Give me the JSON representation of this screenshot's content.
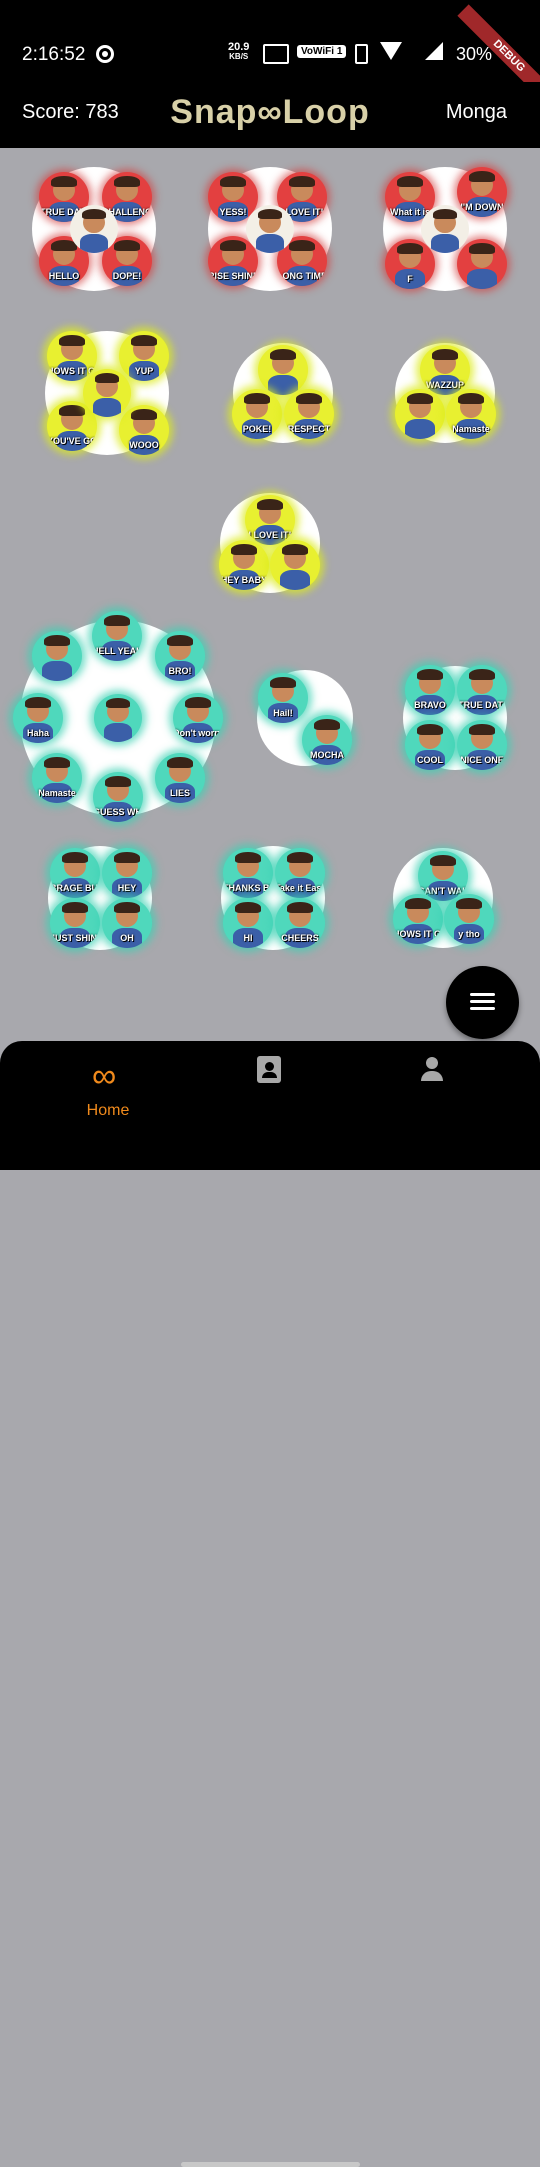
{
  "status_bar": {
    "time": "2:16:52",
    "net_speed_value": "20.9",
    "net_speed_unit": "KB/S",
    "wifi_label": "VoWiFi 1",
    "battery": "30%"
  },
  "debug_banner": "DEBUG",
  "app_bar": {
    "score": "Score: 783",
    "title": "Snap∞Loop",
    "username": "Monga"
  },
  "clusters": [
    {
      "color": "red",
      "stickers": [
        "TRUE DAT!",
        "CHALLENGE",
        "HELLO",
        "DOPE!",
        ""
      ]
    },
    {
      "color": "red",
      "stickers": [
        "YESS!",
        "I LOVE IT!",
        "RISE SHINE",
        "LONG TIME NO SEE",
        ""
      ]
    },
    {
      "color": "red",
      "stickers": [
        "What it is",
        "I'M DOWN",
        "F",
        "",
        ""
      ]
    },
    {
      "color": "yellow",
      "stickers": [
        "HOWS IT GOIN",
        "YUP",
        "YOU'VE GOT MY VOTE",
        "WOOO",
        ""
      ]
    },
    {
      "color": "yellow",
      "stickers": [
        "",
        "POKE!",
        "RESPECT"
      ]
    },
    {
      "color": "yellow",
      "stickers": [
        "WAZZUP",
        "",
        "Namaste"
      ]
    },
    {
      "color": "yellow",
      "stickers": [
        "I LOVE IT!",
        "HEY BABY",
        ""
      ]
    },
    {
      "color": "teal",
      "stickers": [
        "HELL YEAH!",
        "BRO!",
        "Don't worry",
        "LIES",
        "GUESS WHAT",
        "Namaste",
        "Haha",
        ""
      ]
    },
    {
      "color": "teal",
      "stickers": [
        "Hail!",
        "MOCHA"
      ]
    },
    {
      "color": "teal",
      "stickers": [
        "BRAVO",
        "TRUE DAT!",
        "COOL",
        "NICE ONE"
      ]
    },
    {
      "color": "teal",
      "stickers": [
        "BRAGE BURGER",
        "HEY",
        "JUST SHININ'",
        "OH"
      ]
    },
    {
      "color": "teal",
      "stickers": [
        "THANKS BUNCH",
        "Take it Easy",
        "HI",
        "CHEERS"
      ]
    },
    {
      "color": "teal",
      "stickers": [
        "CAN'T WAIT",
        "HOWS IT GOIN",
        "y tho"
      ]
    }
  ],
  "fab": {
    "icon": "menu-icon"
  },
  "bottom_nav": {
    "home_label": "Home",
    "home_icon": "infinity-icon",
    "contacts_icon": "contacts-icon",
    "profile_icon": "person-icon"
  }
}
